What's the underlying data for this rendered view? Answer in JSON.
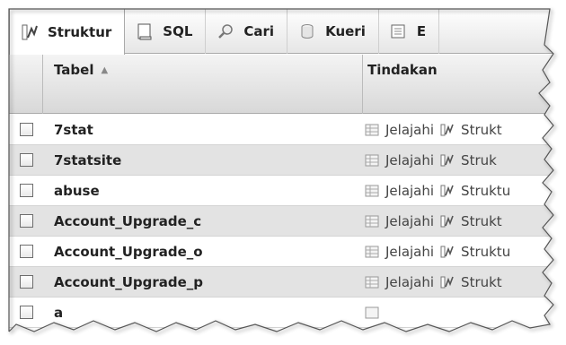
{
  "tabs": [
    {
      "label": "Struktur",
      "icon": "structure-icon",
      "active": true
    },
    {
      "label": "SQL",
      "icon": "sql-icon"
    },
    {
      "label": "Cari",
      "icon": "search-icon"
    },
    {
      "label": "Kueri",
      "icon": "query-icon"
    },
    {
      "label": "E",
      "icon": "export-icon"
    }
  ],
  "table": {
    "col_name": "Tabel",
    "col_actions": "Tindakan",
    "rows": [
      {
        "name": "7stat",
        "browse": "Jelajahi",
        "structure": "Strukt"
      },
      {
        "name": "7statsite",
        "browse": "Jelajahi",
        "structure": "Struk"
      },
      {
        "name": "abuse",
        "browse": "Jelajahi",
        "structure": "Struktu"
      },
      {
        "name": "Account_Upgrade_c",
        "browse": "Jelajahi",
        "structure": "Strukt"
      },
      {
        "name": "Account_Upgrade_o",
        "browse": "Jelajahi",
        "structure": "Struktu"
      },
      {
        "name": "Account_Upgrade_p",
        "browse": "Jelajahi",
        "structure": "Strukt"
      },
      {
        "name": "a",
        "browse": "",
        "structure": ""
      }
    ]
  },
  "colors": {
    "row_even": "#e3e3e3",
    "row_odd": "#ffffff",
    "header": "#d8d8d8"
  }
}
